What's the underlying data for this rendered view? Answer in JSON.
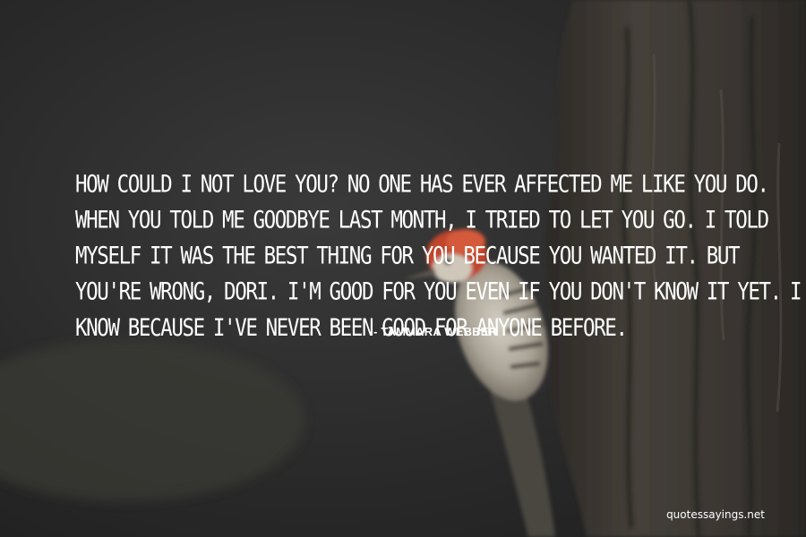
{
  "quote": {
    "lines": [
      "HOW COULD I NOT LOVE YOU? NO ONE HAS EVER AFFECTED ME LIKE YOU DO.",
      "WHEN YOU TOLD ME GOODBYE LAST MONTH, I TRIED TO LET YOU GO. I TOLD",
      "MYSELF IT WAS THE BEST THING FOR YOU BECAUSE YOU WANTED IT. BUT",
      "YOU'RE WRONG, DORI. I'M GOOD FOR YOU EVEN IF YOU DON'T KNOW IT YET. I",
      "KNOW BECAUSE I'VE NEVER BEEN GOOD FOR ANYONE BEFORE."
    ],
    "author": "- TAMMARA WEBBER"
  },
  "watermark": "quotessayings.net",
  "colors": {
    "background": "#2b2b2b",
    "text": "#ffffff",
    "tree_bark": "#3d3935",
    "bird_red": "#c0442a",
    "bird_body": "#b8b2a6"
  }
}
